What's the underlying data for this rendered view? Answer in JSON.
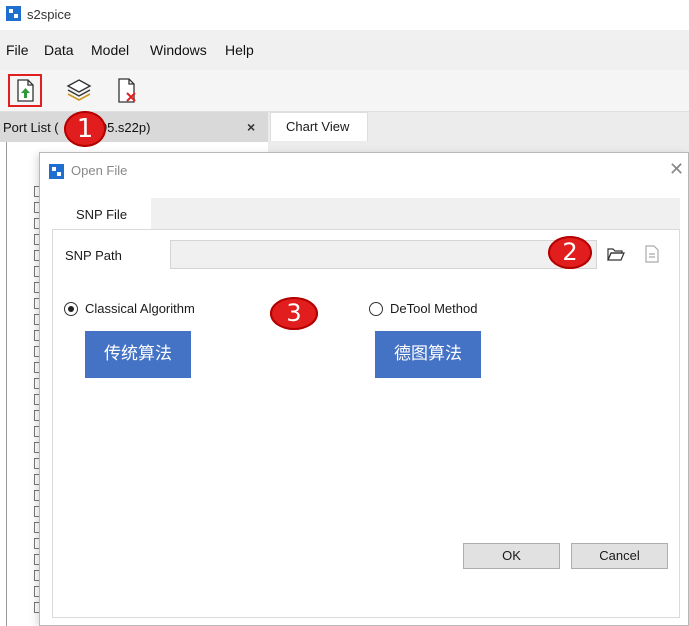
{
  "window": {
    "title": "s2spice"
  },
  "menu": [
    "File",
    "Data",
    "Model",
    "Windows",
    "Help"
  ],
  "toolbar": {
    "open_icon": "file-import-icon",
    "layers_icon": "layers-icon",
    "close_icon": "file-close-icon"
  },
  "port_list": {
    "title": "Port List (",
    "title_suffix": "005.s22p)",
    "close": "×"
  },
  "chart_view": {
    "tab_label": "Chart View"
  },
  "dialog": {
    "title": "Open File",
    "close": "✕",
    "tab": "SNP File",
    "snp_path_label": "SNP Path",
    "snp_path_value": "",
    "radio_classical": "Classical Algorithm",
    "radio_detool": "DeTool Method",
    "classical_selected": true,
    "btn_classical_cn": "传统算法",
    "btn_detool_cn": "德图算法",
    "ok": "OK",
    "cancel": "Cancel"
  },
  "badges": [
    "1",
    "2",
    "3"
  ],
  "colors": {
    "accent_blue": "#4472c4",
    "badge_red": "#e11d1d",
    "app_blue": "#1f6fd1"
  }
}
